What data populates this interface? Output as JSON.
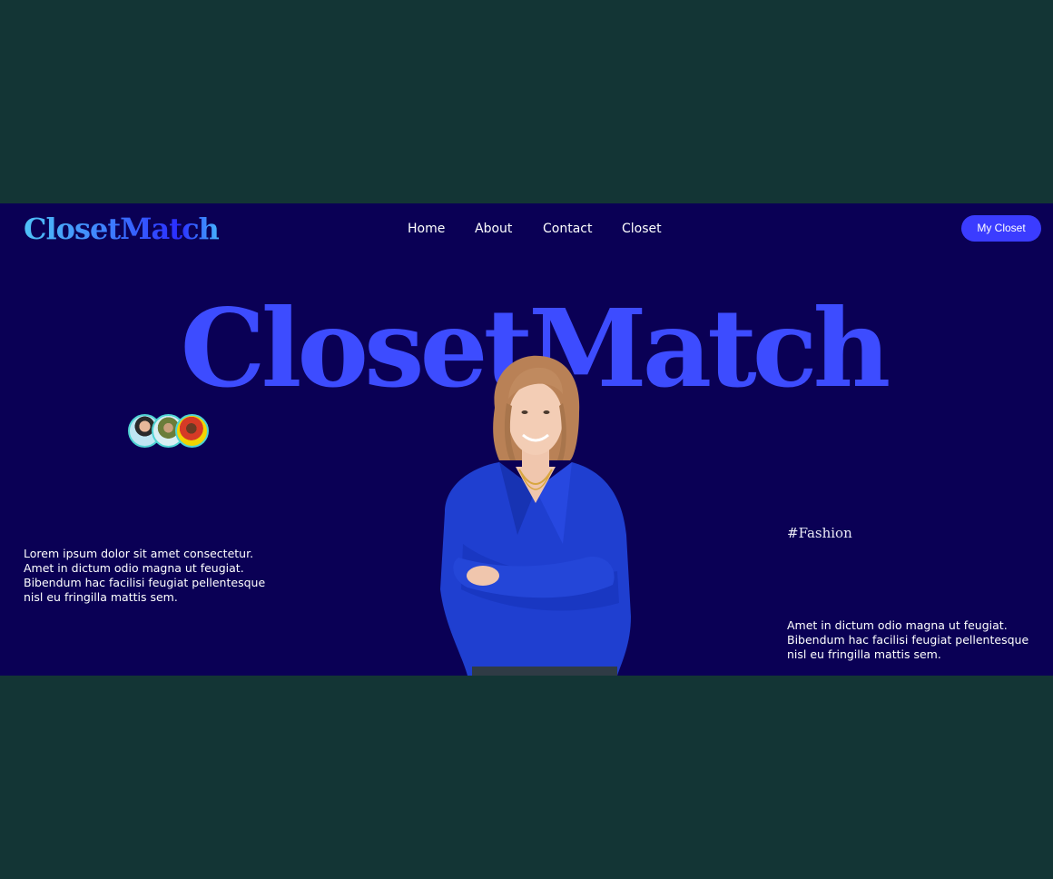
{
  "brand": {
    "logo_text": "ClosetMatch"
  },
  "nav": {
    "items": [
      {
        "label": "Home"
      },
      {
        "label": "About"
      },
      {
        "label": "Contact"
      },
      {
        "label": "Closet"
      }
    ]
  },
  "cta": {
    "label": "My Closet"
  },
  "hero": {
    "title": "ClosetMatch",
    "hashtag": "#Fashion",
    "left_text": "Lorem ipsum dolor sit amet consectetur. Amet in dictum odio magna ut feugiat. Bibendum hac facilisi feugiat pellentesque nisl eu fringilla mattis sem.",
    "right_text": "Amet in dictum odio magna ut feugiat. Bibendum hac facilisi feugiat pellentesque nisl eu fringilla mattis sem."
  },
  "colors": {
    "page_background": "#133535",
    "hero_background": "#0a0055",
    "accent_blue": "#3d4cff",
    "button_blue": "#3b3cff",
    "avatar_ring": "#4fd3d3",
    "blouse_blue": "#1f3fd0"
  },
  "icons": {
    "avatar_group": [
      "avatar-icon",
      "avatar-icon",
      "avatar-icon"
    ]
  }
}
